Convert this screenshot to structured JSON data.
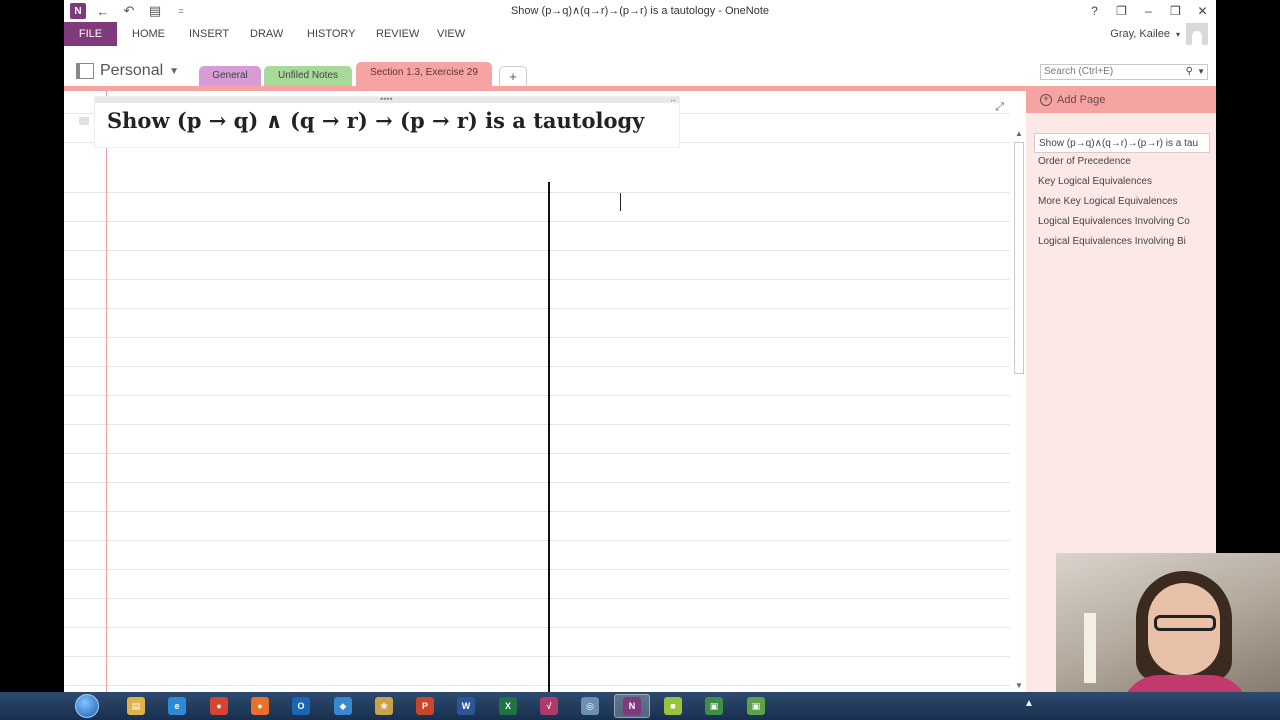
{
  "window": {
    "title": "Show (p→q)∧(q→r)→(p→r) is a tautology - OneNote",
    "controls": [
      "?",
      "❐",
      "–",
      "❒",
      "✕"
    ]
  },
  "quick_access": {
    "back_glyph": "←",
    "undo_glyph": "↶",
    "dock_glyph": "▤",
    "customize_glyph": "="
  },
  "ribbon": {
    "tabs": [
      "FILE",
      "HOME",
      "INSERT",
      "DRAW",
      "HISTORY",
      "REVIEW",
      "VIEW"
    ],
    "user_name": "Gray, Kailee"
  },
  "notebook": {
    "name": "Personal",
    "sections": [
      "General",
      "Unfiled Notes",
      "Section 1.3, Exercise 29"
    ],
    "add_section_label": "+"
  },
  "search": {
    "placeholder": "Search (Ctrl+E)"
  },
  "page": {
    "title": "Show (p → q) ∧ (q → r) → (p → r) is a tautology"
  },
  "page_list": {
    "add_page_label": "Add Page",
    "pages": [
      "Show (p→q)∧(q→r)→(p→r) is a tau",
      "Order of Precedence",
      "Key Logical Equivalences",
      "More Key Logical Equivalences",
      "Logical Equivalences Involving Co",
      "Logical Equivalences Involving Bi"
    ],
    "selected_index": 0
  },
  "taskbar": {
    "apps": [
      {
        "name": "file-explorer",
        "glyph": "▤",
        "color": "#e0b24a"
      },
      {
        "name": "internet-explorer",
        "glyph": "e",
        "color": "#2b8ad8"
      },
      {
        "name": "chrome",
        "glyph": "●",
        "color": "#d64533"
      },
      {
        "name": "firefox",
        "glyph": "●",
        "color": "#e8702a"
      },
      {
        "name": "outlook",
        "glyph": "O",
        "color": "#1b65b5"
      },
      {
        "name": "app-blue",
        "glyph": "◆",
        "color": "#3a86d1"
      },
      {
        "name": "app-paint",
        "glyph": "❀",
        "color": "#c9a24a"
      },
      {
        "name": "powerpoint",
        "glyph": "P",
        "color": "#c8472a"
      },
      {
        "name": "word",
        "glyph": "W",
        "color": "#2b579a"
      },
      {
        "name": "excel",
        "glyph": "X",
        "color": "#217346"
      },
      {
        "name": "mathtype",
        "glyph": "√",
        "color": "#b03a6a"
      },
      {
        "name": "app-globe",
        "glyph": "◎",
        "color": "#6b8fb3"
      },
      {
        "name": "onenote",
        "glyph": "N",
        "color": "#80397b"
      },
      {
        "name": "app-chat",
        "glyph": "■",
        "color": "#9ac23c"
      },
      {
        "name": "app-green-1",
        "glyph": "▣",
        "color": "#3f8f4a"
      },
      {
        "name": "app-green-2",
        "glyph": "▣",
        "color": "#5ea14b"
      }
    ],
    "tray_glyph": "▲"
  },
  "colors": {
    "onenote_purple": "#80397b",
    "active_section": "#f5a3a3",
    "general_section": "#d79bd6",
    "unfiled_section": "#a8d99a"
  }
}
